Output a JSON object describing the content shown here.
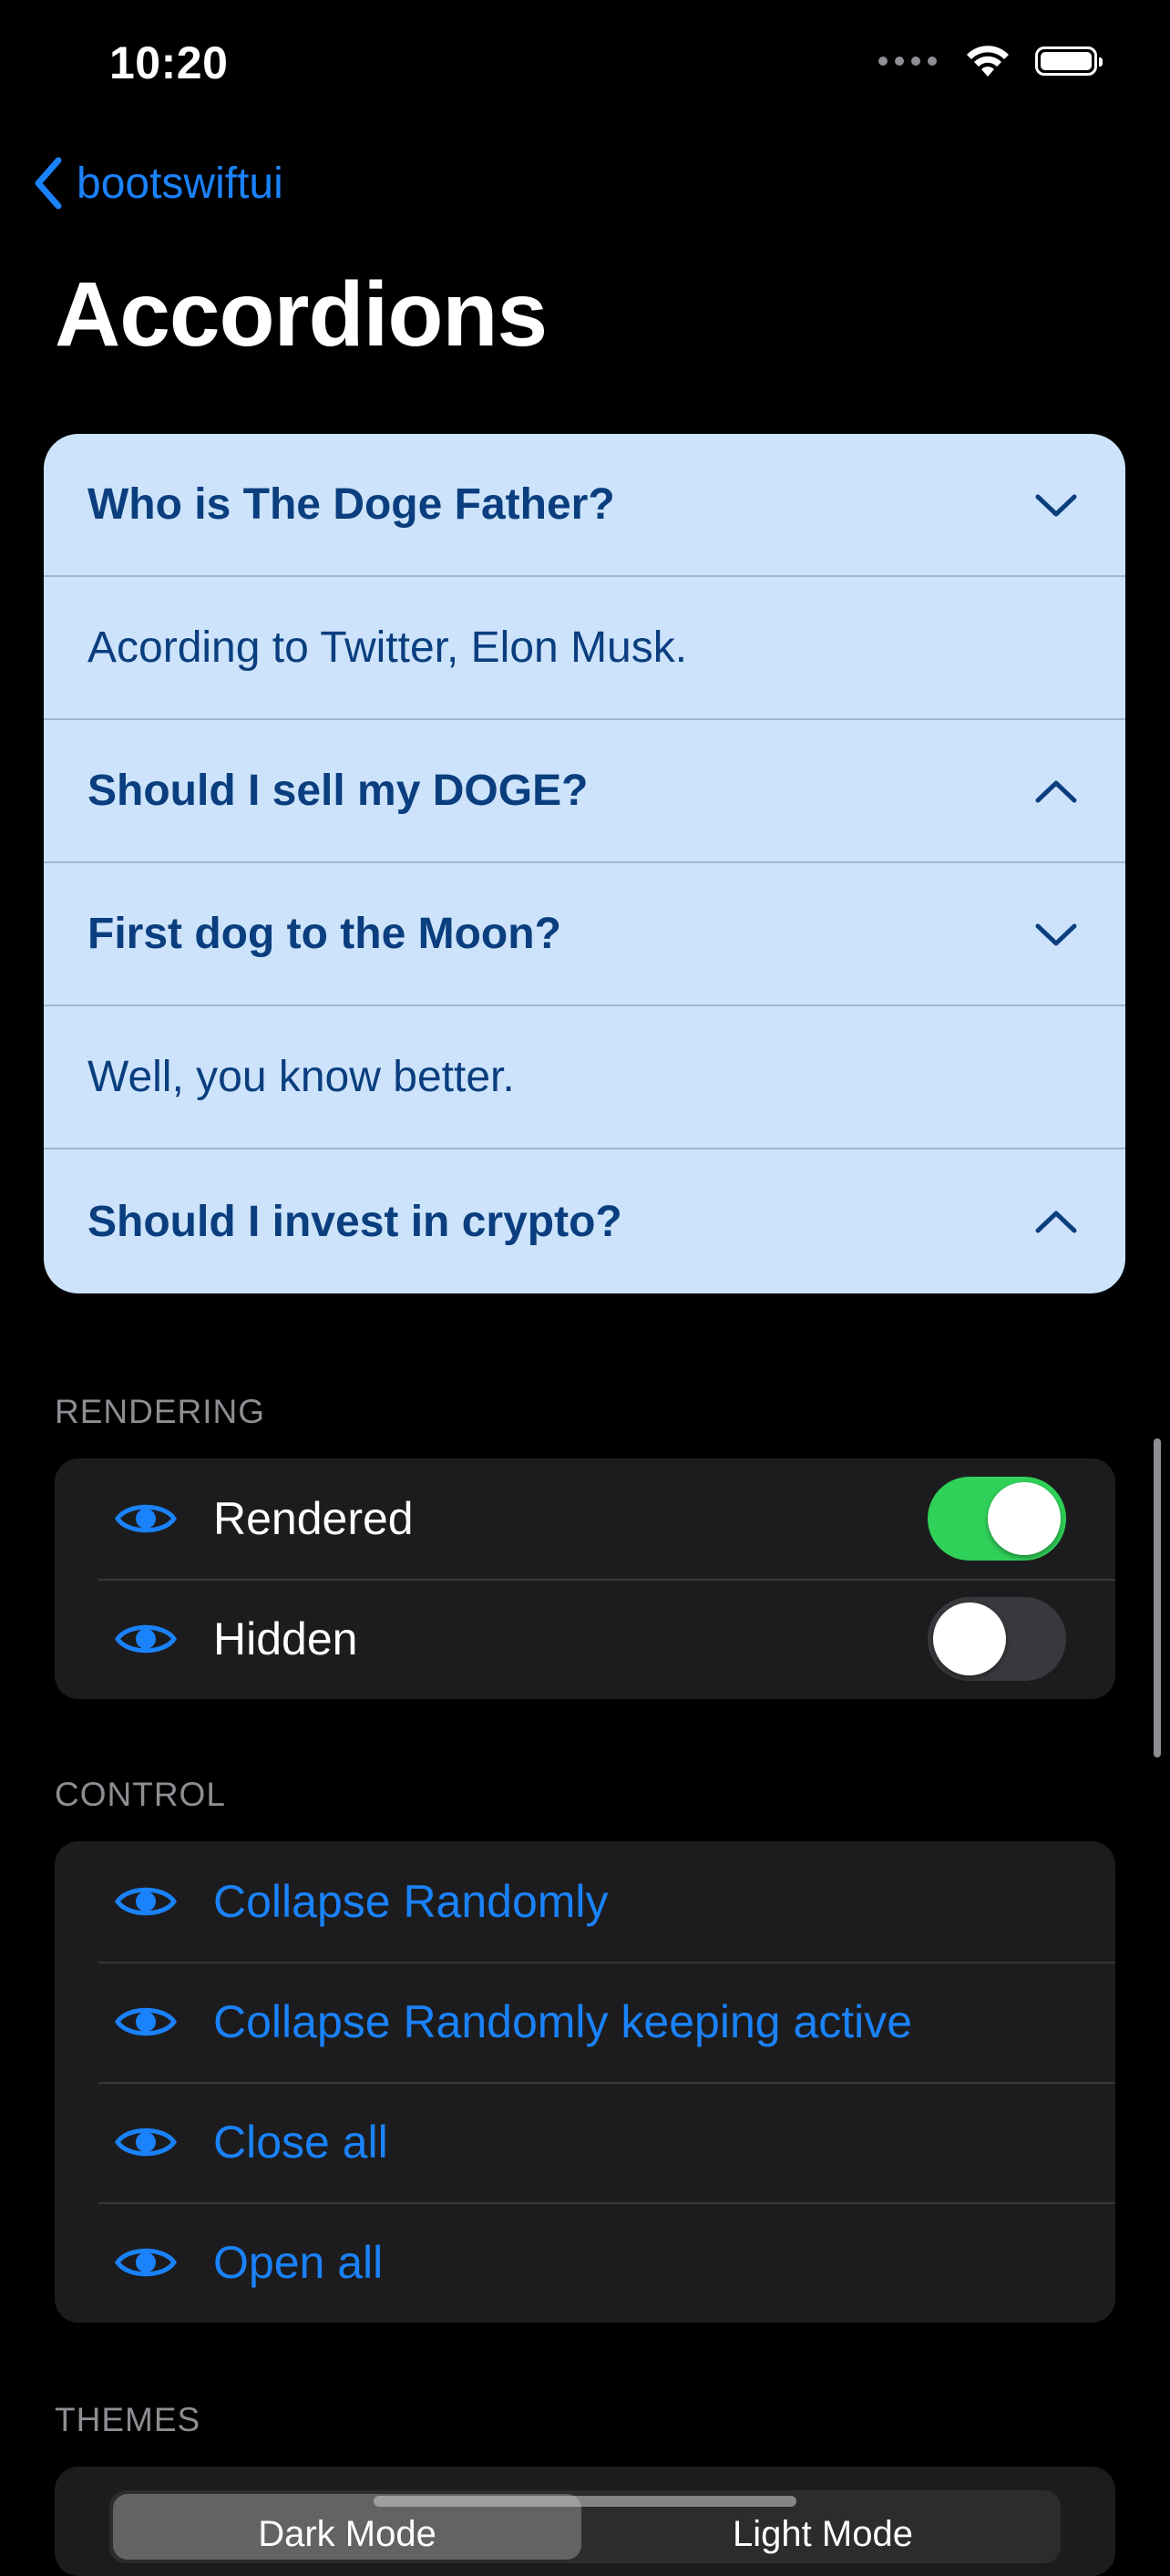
{
  "status_bar": {
    "time": "10:20"
  },
  "nav": {
    "back_label": "bootswiftui",
    "title": "Accordions"
  },
  "accordion": {
    "items": [
      {
        "text": "Who is The Doge Father?",
        "kind": "header",
        "icon": "chevron-down-icon"
      },
      {
        "text": "Acording to Twitter, Elon Musk.",
        "kind": "content"
      },
      {
        "text": "Should I sell my DOGE?",
        "kind": "header",
        "icon": "chevron-up-icon"
      },
      {
        "text": "First dog to the Moon?",
        "kind": "header",
        "icon": "chevron-down-icon"
      },
      {
        "text": "Well, you know better.",
        "kind": "content"
      },
      {
        "text": "Should I invest in crypto?",
        "kind": "header",
        "icon": "chevron-up-icon"
      }
    ]
  },
  "rendering": {
    "label": "RENDERING",
    "rows": [
      {
        "label": "Rendered",
        "on": true,
        "icon": "eye-icon"
      },
      {
        "label": "Hidden",
        "on": false,
        "icon": "eye-icon"
      }
    ]
  },
  "control": {
    "label": "CONTROL",
    "rows": [
      {
        "label": "Collapse Randomly",
        "icon": "eye-icon"
      },
      {
        "label": "Collapse Randomly keeping active",
        "icon": "eye-icon"
      },
      {
        "label": "Close all",
        "icon": "eye-icon"
      },
      {
        "label": "Open all",
        "icon": "eye-icon"
      }
    ]
  },
  "themes": {
    "label": "THEMES",
    "options": [
      "Dark Mode",
      "Light Mode"
    ],
    "selected": "Dark Mode"
  },
  "colors": {
    "accent": "#1a82fb",
    "accordion_bg": "#cce3fb",
    "accordion_text": "#0a3e7e",
    "toggle_on": "#30d158"
  }
}
